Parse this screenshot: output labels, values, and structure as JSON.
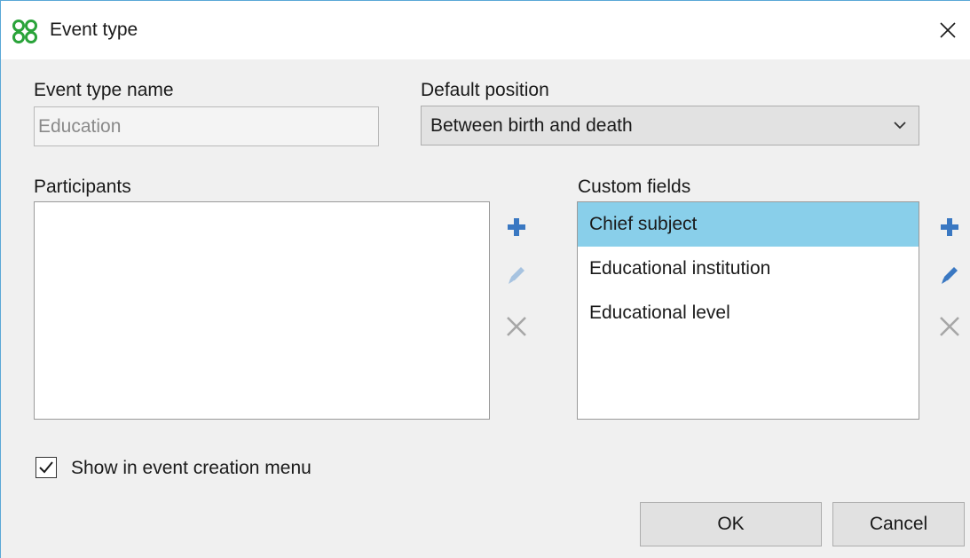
{
  "window": {
    "title": "Event type",
    "app_icon": "multi-circle-logo-icon",
    "close_icon": "close-icon"
  },
  "form": {
    "event_type_name_label": "Event type name",
    "event_type_name_value": "Education",
    "default_position_label": "Default position",
    "default_position_value": "Between birth and death",
    "participants_label": "Participants",
    "participants": [],
    "custom_fields_label": "Custom fields",
    "custom_fields": [
      {
        "label": "Chief subject",
        "selected": true
      },
      {
        "label": "Educational institution",
        "selected": false
      },
      {
        "label": "Educational level",
        "selected": false
      }
    ],
    "show_in_menu_label": "Show in event creation menu",
    "show_in_menu_checked": true
  },
  "toolbar_icons": {
    "add": "plus-icon",
    "edit": "pencil-icon",
    "remove": "x-icon"
  },
  "buttons": {
    "ok": "OK",
    "cancel": "Cancel"
  },
  "colors": {
    "accent": "#3a78c2",
    "selection": "#89cfea",
    "icon_disabled": "#a7a7a7",
    "logo_green": "#2aa33a"
  }
}
